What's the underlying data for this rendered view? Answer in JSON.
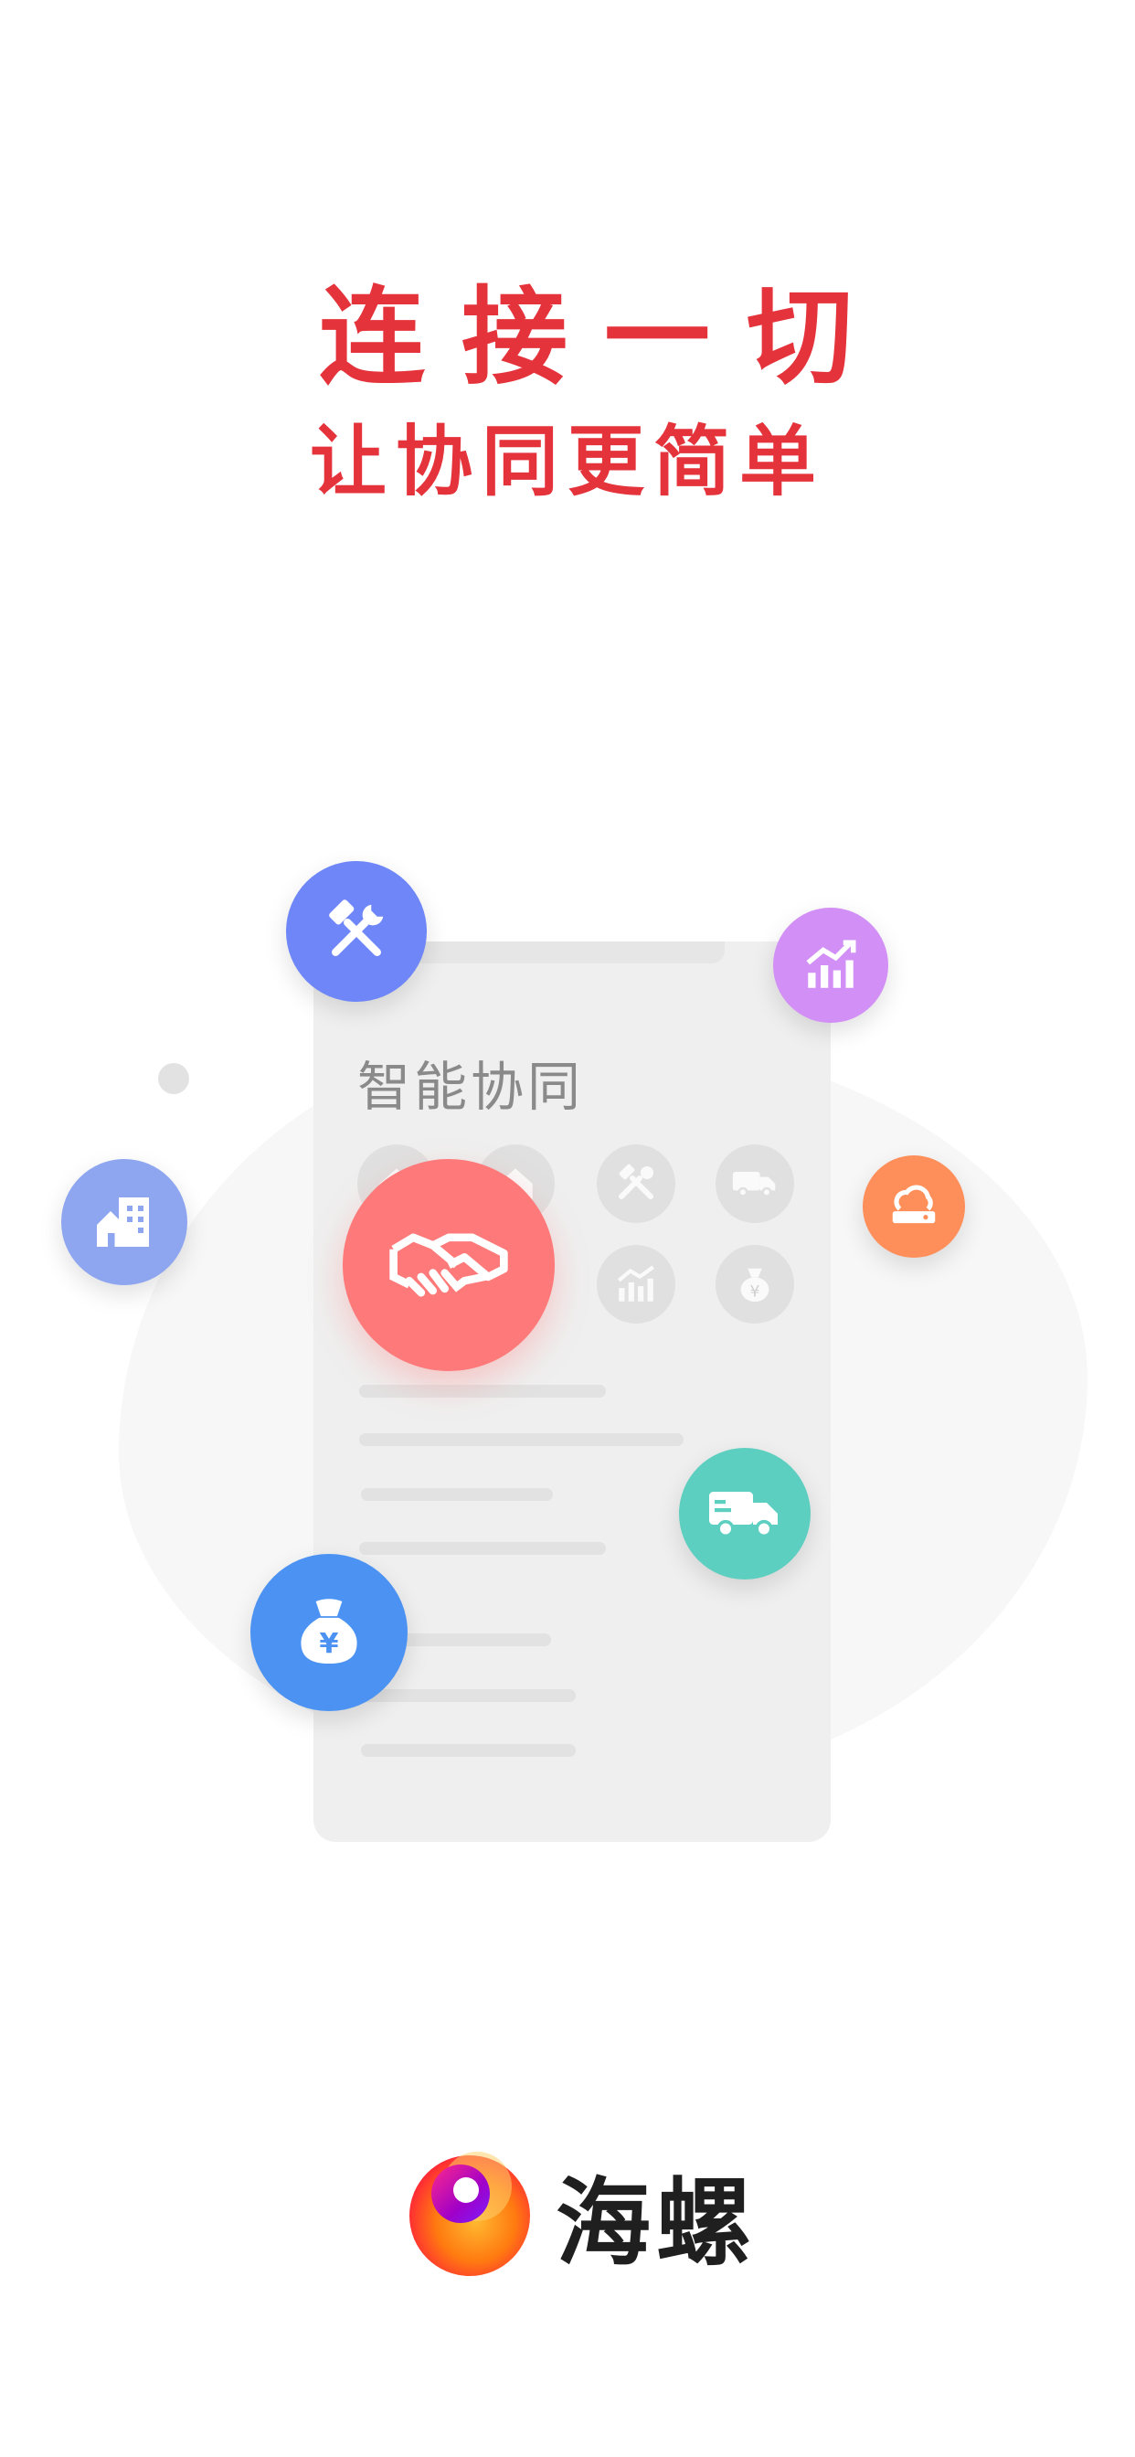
{
  "headline": {
    "line1": "连接一切",
    "line2": "让协同更简单"
  },
  "card": {
    "title": "智能协同",
    "grid_icons": [
      "home-icon",
      "home-icon",
      "tools-icon",
      "truck-icon",
      "chart-icon",
      "chart-icon",
      "money-bag-icon"
    ]
  },
  "bubbles": [
    {
      "name": "tools-bubble",
      "icon": "tools-icon",
      "color": "#6e86f7"
    },
    {
      "name": "chart-bubble",
      "icon": "chart-icon",
      "color": "#d28ff6"
    },
    {
      "name": "building-bubble",
      "icon": "building-icon",
      "color": "#8ea6f0"
    },
    {
      "name": "cloud-server-bubble",
      "icon": "cloud-server-icon",
      "color": "#ff8f5a"
    },
    {
      "name": "handshake-bubble",
      "icon": "handshake-icon",
      "color": "#fe7a7a"
    },
    {
      "name": "truck-bubble",
      "icon": "truck-icon",
      "color": "#5dcfc0"
    },
    {
      "name": "money-bag-bubble",
      "icon": "money-bag-icon",
      "color": "#4b92f2"
    }
  ],
  "brand": {
    "name": "海螺",
    "logo_colors": [
      "#ff1f3a",
      "#ff7a10",
      "#ffb830",
      "#a000c8",
      "#7a1fff"
    ]
  }
}
